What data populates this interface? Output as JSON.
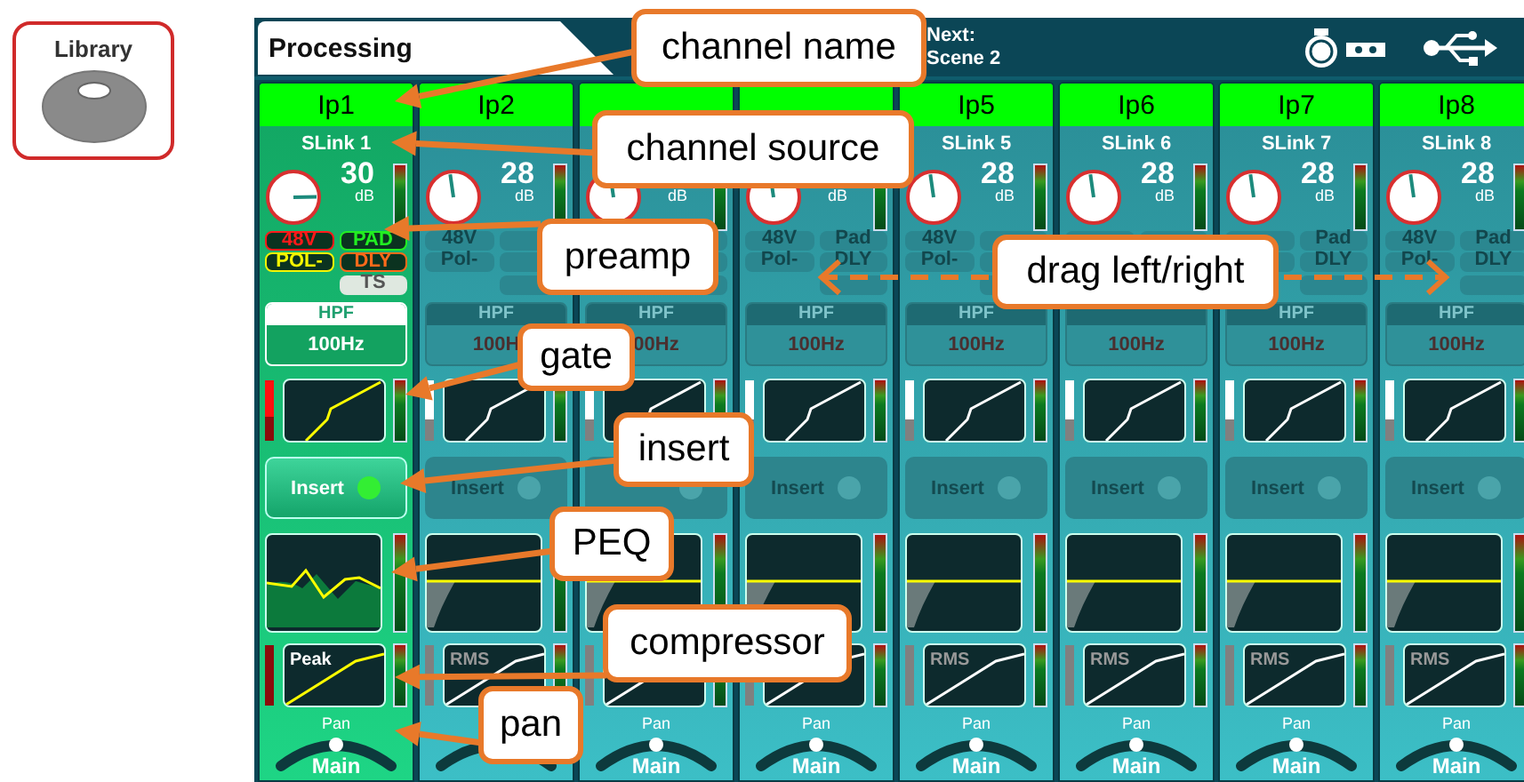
{
  "library": {
    "label": "Library"
  },
  "header": {
    "title": "Processing",
    "next_label": "Next:",
    "next_scene": "Scene 2"
  },
  "channels": [
    {
      "name": "Ip1",
      "selected": true,
      "source": "SLink 1",
      "gain": "30",
      "unit": "dB",
      "level": 0.83,
      "flags": [
        {
          "label": "48V",
          "on": true,
          "kind": "toggle",
          "color": "#ff1a1a"
        },
        {
          "label": "PAD",
          "on": true,
          "kind": "toggle",
          "color": "#22ee22"
        },
        {
          "label": "POL-",
          "on": true,
          "kind": "toggle",
          "color": "#f5f500"
        },
        {
          "label": "DLY",
          "on": true,
          "kind": "toggle",
          "color": "#ff6a1a"
        },
        {
          "label": "TS",
          "on": true,
          "kind": "badge"
        }
      ],
      "hpf": {
        "label": "HPF",
        "value": "100Hz"
      },
      "insert": {
        "label": "Insert",
        "on": true
      },
      "comp": {
        "detector": "Peak"
      },
      "pan": {
        "label": "Pan",
        "bus": "Main"
      }
    },
    {
      "name": "Ip2",
      "selected": false,
      "gain": "28",
      "unit": "dB",
      "level": 0.47,
      "flags": [
        {
          "label": "48V",
          "on": false,
          "kind": "toggle"
        },
        {
          "kind": "toggle"
        },
        {
          "label": "Pol-",
          "on": false,
          "kind": "toggle"
        },
        {
          "kind": "toggle"
        }
      ],
      "hpf": {
        "label": "HPF",
        "value": "100H"
      },
      "insert": {
        "label": "Insert",
        "on": false
      },
      "comp": {
        "detector": "RMS"
      }
    },
    {
      "selected": false,
      "unit": "dB",
      "level": 0.47,
      "hpf": {
        "label": "HPF",
        "value": "00Hz"
      },
      "insert": {
        "on": false
      },
      "pan": {
        "label": "Pan",
        "bus": "Main"
      }
    },
    {
      "selected": false,
      "unit": "dB",
      "level": 0.47,
      "flags": [
        {
          "label": "48V",
          "on": false,
          "kind": "toggle"
        },
        {
          "label": "Pad",
          "on": false,
          "kind": "toggle"
        },
        {
          "label": "Pol-",
          "on": false,
          "kind": "toggle"
        },
        {
          "label": "DLY",
          "on": false,
          "kind": "toggle"
        }
      ],
      "hpf": {
        "label": "HPF",
        "value": "100Hz"
      },
      "insert": {
        "label": "Insert",
        "on": false
      },
      "pan": {
        "label": "Pan",
        "bus": "Main"
      }
    },
    {
      "name": "Ip5",
      "selected": false,
      "source": "SLink 5",
      "gain": "28",
      "unit": "dB",
      "level": 0.47,
      "flags": [
        {
          "label": "48V",
          "on": false,
          "kind": "toggle"
        },
        {
          "kind": "toggle"
        },
        {
          "label": "Pol-",
          "on": false,
          "kind": "toggle"
        },
        {
          "kind": "toggle"
        }
      ],
      "hpf": {
        "label": "HPF",
        "value": "100Hz"
      },
      "insert": {
        "label": "Insert",
        "on": false
      },
      "comp": {
        "detector": "RMS"
      },
      "pan": {
        "label": "Pan",
        "bus": "Main"
      }
    },
    {
      "name": "Ip6",
      "selected": false,
      "source": "SLink 6",
      "gain": "28",
      "unit": "dB",
      "level": 0.47,
      "hpf": {
        "value": "100Hz"
      },
      "insert": {
        "label": "Insert",
        "on": false
      },
      "comp": {
        "detector": "RMS"
      },
      "pan": {
        "label": "Pan",
        "bus": "Main"
      }
    },
    {
      "name": "Ip7",
      "selected": false,
      "source": "SLink 7",
      "gain": "28",
      "unit": "dB",
      "level": 0.47,
      "flags": [
        {
          "kind": "toggle"
        },
        {
          "label": "Pad",
          "on": false,
          "kind": "toggle"
        },
        {
          "kind": "toggle"
        },
        {
          "label": "DLY",
          "on": false,
          "kind": "toggle"
        }
      ],
      "hpf": {
        "label": "HPF",
        "value": "100Hz"
      },
      "insert": {
        "label": "Insert",
        "on": false
      },
      "comp": {
        "detector": "RMS"
      },
      "pan": {
        "label": "Pan",
        "bus": "Main"
      }
    },
    {
      "name": "Ip8",
      "selected": false,
      "source": "SLink 8",
      "gain": "28",
      "unit": "dB",
      "level": 0.47,
      "flags": [
        {
          "label": "48V",
          "on": false,
          "kind": "toggle"
        },
        {
          "label": "Pad",
          "on": false,
          "kind": "toggle"
        },
        {
          "label": "Pol-",
          "on": false,
          "kind": "toggle"
        },
        {
          "label": "DLY",
          "on": false,
          "kind": "toggle"
        }
      ],
      "hpf": {
        "label": "HPF",
        "value": "100Hz"
      },
      "insert": {
        "label": "Insert",
        "on": false
      },
      "comp": {
        "detector": "RMS"
      },
      "pan": {
        "label": "Pan",
        "bus": "Main"
      }
    }
  ],
  "callouts": [
    {
      "text": "channel name"
    },
    {
      "text": "channel source"
    },
    {
      "text": "preamp"
    },
    {
      "text": "drag left/right"
    },
    {
      "text": "gate"
    },
    {
      "text": "insert"
    },
    {
      "text": "PEQ"
    },
    {
      "text": "compressor"
    },
    {
      "text": "pan"
    }
  ]
}
